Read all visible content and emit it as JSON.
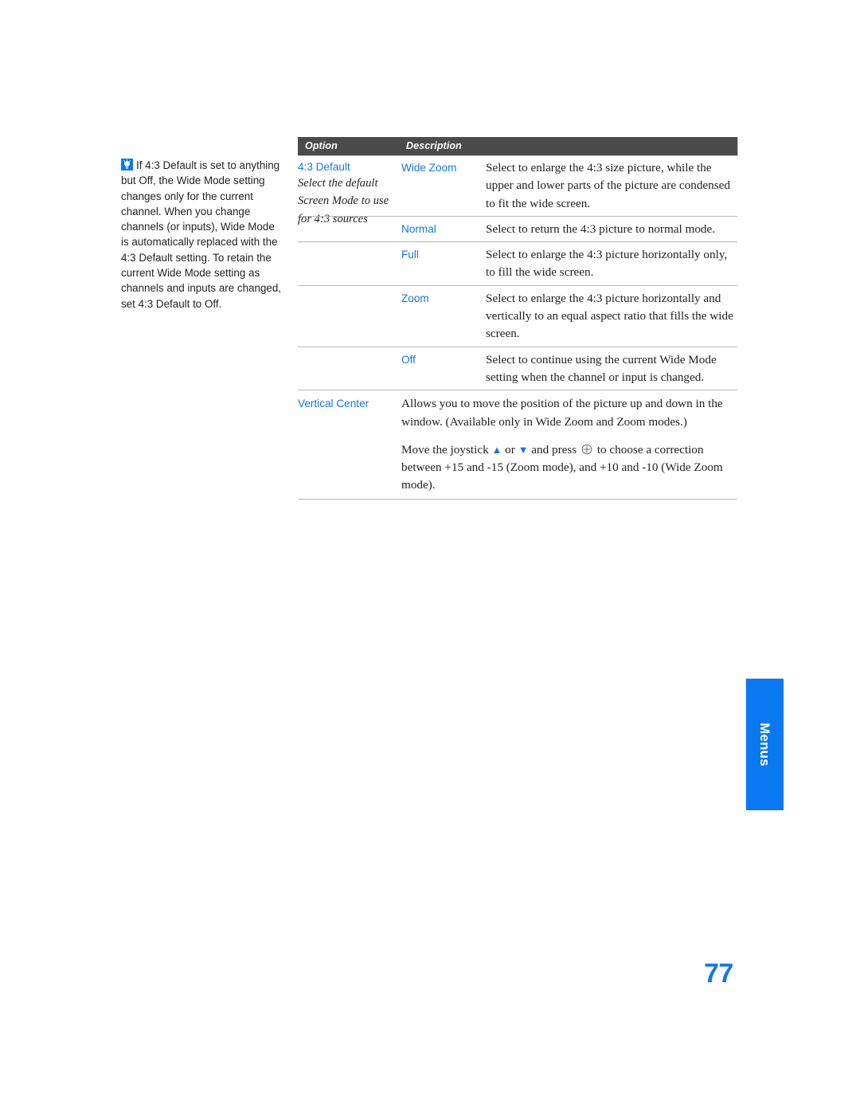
{
  "colors": {
    "accent_blue": "#1878e0",
    "tab_blue": "#0a78f0",
    "header_gray": "#4b4b4b",
    "rule_gray": "#b8b8b8",
    "body_text": "#231f20"
  },
  "tip_note": {
    "icon": "lightbulb-icon",
    "text": "If 4:3 Default is set to anything but Off, the Wide Mode setting changes only for the current channel. When you change channels (or inputs), Wide Mode is automatically replaced with the 4:3 Default setting. To retain the current Wide Mode setting as channels and inputs are changed, set 4:3 Default to Off."
  },
  "table": {
    "headers": {
      "option": "Option",
      "description": "Description"
    },
    "option_group": {
      "title": "4:3 Default",
      "subtitle": "Select the default Screen Mode to use for 4:3 sources"
    },
    "sub_rows": [
      {
        "label": "Wide Zoom",
        "text": "Select to enlarge the 4:3 size picture, while the upper and lower parts of the picture are condensed to fit the wide screen."
      },
      {
        "label": "Normal",
        "text": "Select to return the 4:3 picture to normal mode."
      },
      {
        "label": "Full",
        "text": "Select to enlarge the 4:3 picture horizontally only, to fill the wide screen."
      },
      {
        "label": "Zoom",
        "text": "Select to enlarge the 4:3 picture horizontally and vertically to an equal aspect ratio that fills the wide screen."
      },
      {
        "label": "Off",
        "text": "Select to continue using the current Wide Mode setting when the channel or input is changed."
      }
    ],
    "vertical_center": {
      "label": "Vertical Center",
      "paragraph1": "Allows you to move the position of the picture up and down in the window. (Available only in Wide Zoom and Zoom modes.)",
      "paragraph2_part1": "Move the joystick",
      "paragraph2_up_arrow": "♦",
      "paragraph2_or": "or",
      "paragraph2_down_arrow": "♦",
      "paragraph2_part2": "and press",
      "paragraph2_select_icon": "select-button-icon",
      "paragraph2_part3": "to choose a correction between +15 and -15 (Zoom mode), and +10 and -10 (Wide Zoom mode)."
    }
  },
  "side_tab": {
    "label": "Menus"
  },
  "page_number": "77"
}
